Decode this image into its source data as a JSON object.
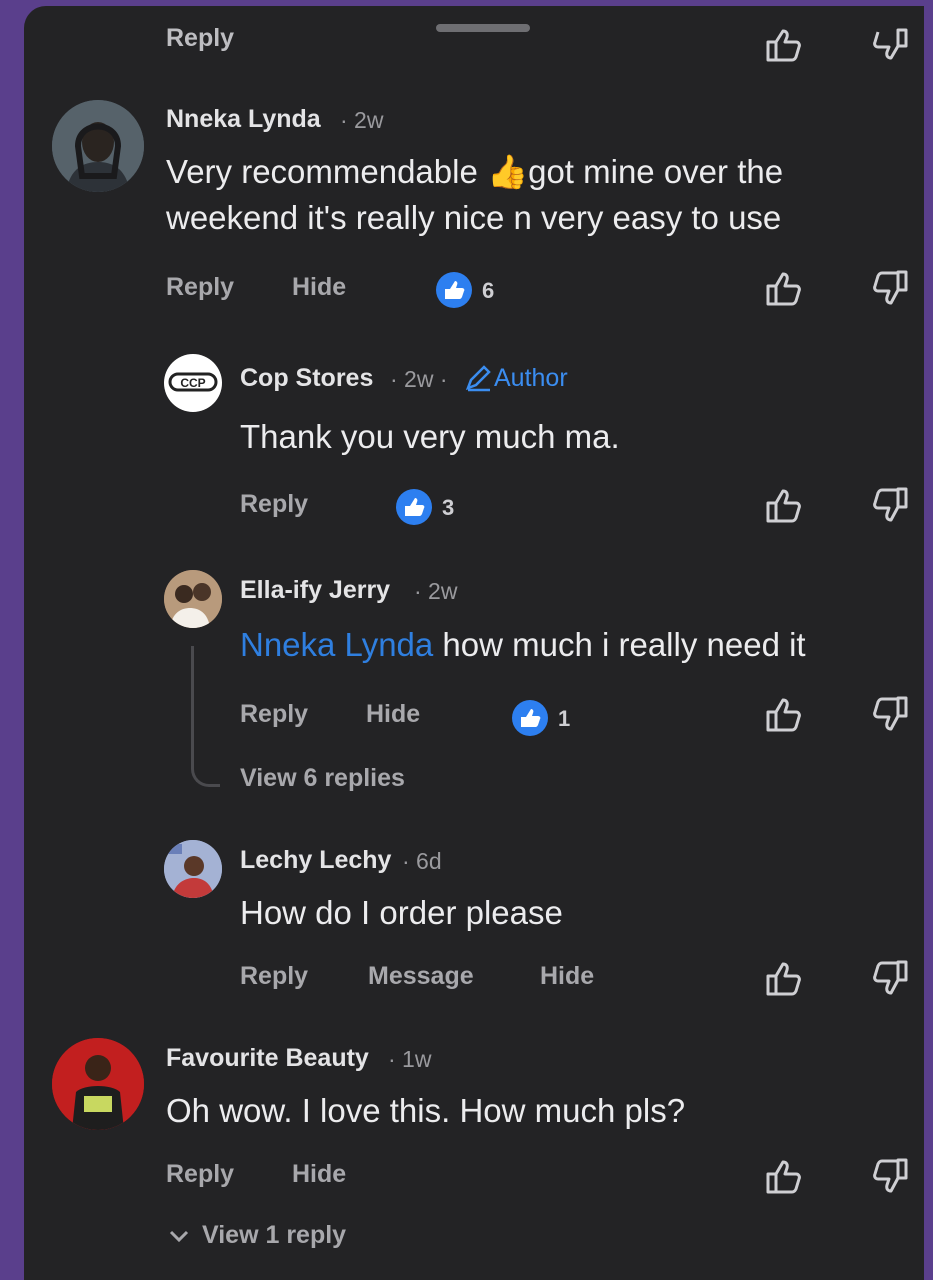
{
  "top": {
    "reply_label": "Reply"
  },
  "comments": [
    {
      "name": "Nneka Lynda",
      "time": "· 2w",
      "text_line1": "Very recommendable ",
      "emoji": "👍",
      "text_line1b": "got mine over the",
      "text_line2": "weekend it's really nice n very easy to use",
      "actions": [
        "Reply",
        "Hide"
      ],
      "likes": "6"
    },
    {
      "name": "Cop Stores",
      "time": "· 2w ·",
      "badge": "Author",
      "avatar_text": "CCP",
      "text": "Thank you very much ma.",
      "actions": [
        "Reply"
      ],
      "likes": "3"
    },
    {
      "name": "Ella-ify Jerry",
      "time": "· 2w",
      "mention": "Nneka Lynda",
      "text": " how much i really need it",
      "actions": [
        "Reply",
        "Hide"
      ],
      "likes": "1",
      "view_replies": "View 6 replies"
    },
    {
      "name": "Lechy Lechy",
      "time": "· 6d",
      "text": "How do I order please",
      "actions": [
        "Reply",
        "Message",
        "Hide"
      ]
    },
    {
      "name": "Favourite Beauty",
      "time": "· 1w",
      "text": "Oh wow. I love this. How much pls?",
      "actions": [
        "Reply",
        "Hide"
      ],
      "view_replies": "View 1 reply"
    }
  ],
  "colors": {
    "background": "#232325",
    "frame": "#5a3f8c",
    "accent": "#2d7ff0",
    "mention": "#2f7fe0"
  }
}
